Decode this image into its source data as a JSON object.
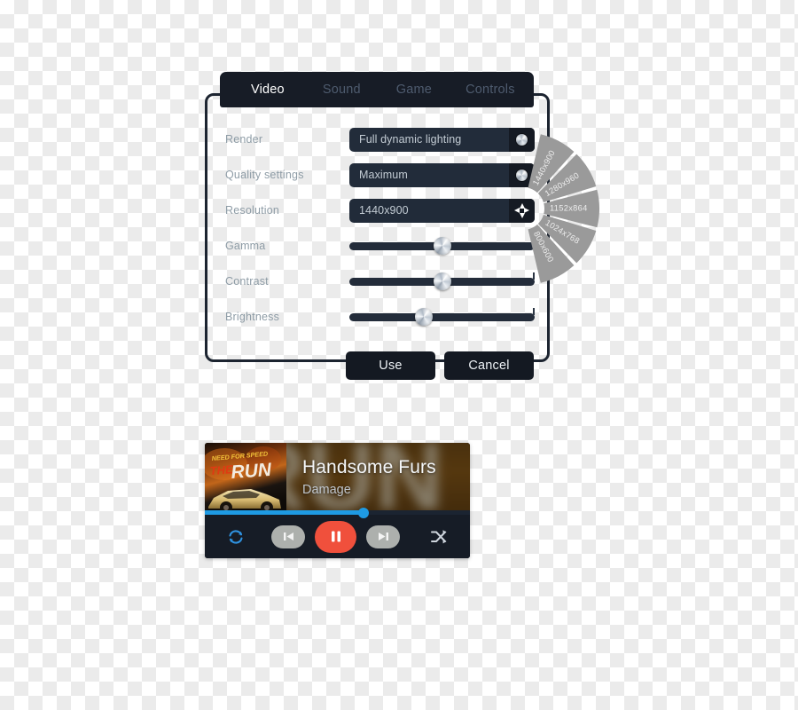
{
  "settings_panel": {
    "tabs": [
      {
        "label": "Video",
        "active": true
      },
      {
        "label": "Sound",
        "active": false
      },
      {
        "label": "Game",
        "active": false
      },
      {
        "label": "Controls",
        "active": false
      }
    ],
    "rows": [
      {
        "label": "Render",
        "type": "select",
        "value": "Full dynamic lighting",
        "icon": "round-knob-icon"
      },
      {
        "label": "Quality settings",
        "type": "select",
        "value": "Maximum",
        "icon": "round-knob-icon"
      },
      {
        "label": "Resolution",
        "type": "select",
        "value": "1440x900",
        "icon": "expand-arrows-icon",
        "active": true
      },
      {
        "label": "Gamma",
        "type": "slider",
        "value": 50
      },
      {
        "label": "Contrast",
        "type": "slider",
        "value": 50
      },
      {
        "label": "Brightness",
        "type": "slider",
        "value": 40
      }
    ],
    "buttons": {
      "use_label": "Use",
      "cancel_label": "Cancel"
    },
    "colors": {
      "panel_border": "#1c2430",
      "tabbar_bg": "#171c26",
      "field_bg": "#222c3a",
      "label_text": "#8e9ca6",
      "value_text": "#c3ccd4",
      "tab_active_text": "#ffffff",
      "tab_inactive_text": "#4e5b6e",
      "button_bg": "#141922"
    }
  },
  "radial_menu": {
    "name": "resolution-radial-menu",
    "options": [
      "1440x900",
      "1280x960",
      "1152x864",
      "1024x768",
      "800x600"
    ],
    "selected": "1440x900",
    "fill": "#9a9a9a"
  },
  "player": {
    "track_title": "Handsome Furs",
    "track_artist": "Damage",
    "album_art_title_line1": "NEED FOR SPEED",
    "album_art_title_line2": "THE",
    "album_art_title_line3": "RUN",
    "progress_percent": 60,
    "controls": [
      {
        "name": "repeat-icon",
        "label": "repeat"
      },
      {
        "name": "previous-icon",
        "label": "previous"
      },
      {
        "name": "pause-icon",
        "label": "pause"
      },
      {
        "name": "next-icon",
        "label": "next"
      },
      {
        "name": "shuffle-icon",
        "label": "shuffle"
      }
    ],
    "colors": {
      "accent": "#1e9ae3",
      "pause_button": "#f0503c",
      "skip_button": "#adb0ad",
      "controls_bg": "#161c26"
    }
  }
}
